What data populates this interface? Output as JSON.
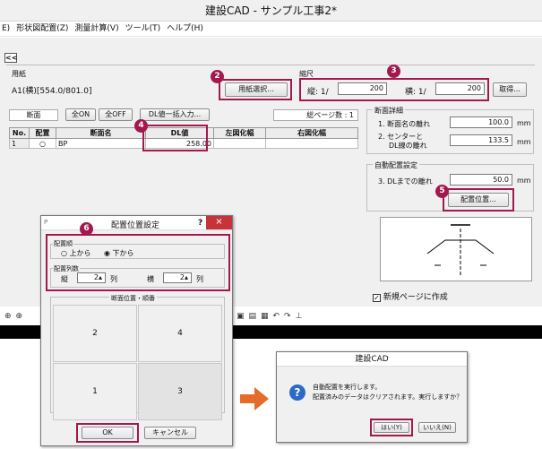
{
  "window": {
    "title": "建設CAD - サンプル工事2*"
  },
  "menu": [
    "E)",
    "形状図配置(Z)",
    "測量計算(V)",
    "ツール(T)",
    "ヘルプ(H)"
  ],
  "collapse_label": "<<",
  "paper": {
    "section_label": "用紙",
    "value": "A1(横)[554.0/801.0]",
    "select_button": "用紙選択..."
  },
  "scale": {
    "section_label": "縮尺",
    "vertical_label": "縦: 1/",
    "vertical_value": "200",
    "horizontal_label": "横: 1/",
    "horizontal_value": "200",
    "fetch_button": "取得..."
  },
  "section_tab": {
    "label": "断面",
    "all_on": "全ON",
    "all_off": "全OFF",
    "dl_bulk": "DL値一括入力...",
    "total_pages": "総ページ数 : 1"
  },
  "table": {
    "headers": [
      "No.",
      "配置",
      "断面名",
      "DL値",
      "左図化幅",
      "右図化幅"
    ],
    "rows": [
      {
        "no": "1",
        "place": "○",
        "name": "BP",
        "dl": "258.00",
        "left": "",
        "right": ""
      }
    ]
  },
  "detail": {
    "label": "断面詳細",
    "row1_label": "1. 断面名の離れ",
    "row1_value": "100.0",
    "row1_unit": "mm",
    "row2_label_a": "2. センターと",
    "row2_label_b": "DL線の離れ",
    "row2_value": "133.5",
    "row2_unit": "mm"
  },
  "auto": {
    "label": "自動配置設定",
    "row3_label": "3. DLまでの離れ",
    "row3_value": "50.0",
    "row3_unit": "mm",
    "placement_button": "配置位置..."
  },
  "new_page": {
    "label": "新規ページに作成",
    "checked": true
  },
  "badges": [
    "2",
    "3",
    "4",
    "5",
    "6"
  ],
  "dialog": {
    "title": "配置位置設定",
    "help": "?",
    "close": "×",
    "order_label": "配置順",
    "order_top": "上から",
    "order_bottom": "下から",
    "cols_label": "配置列数",
    "vertical_label": "縦",
    "vertical_value": "2",
    "vertical_unit": "列",
    "horizontal_label": "横",
    "horizontal_value": "2",
    "horizontal_unit": "列",
    "grid_label": "断面位置・順番",
    "cells": [
      "2",
      "4",
      "1",
      "3"
    ],
    "ok": "OK",
    "cancel": "キャンセル"
  },
  "confirm": {
    "title": "建設CAD",
    "line1": "自動配置を実行します。",
    "line2": "配置済みのデータはクリアされます。実行しますか？",
    "yes": "はい(Y)",
    "no": "いいえ(N)"
  },
  "colors": {
    "accent": "#a3184e",
    "arrow": "#e46b2a"
  }
}
